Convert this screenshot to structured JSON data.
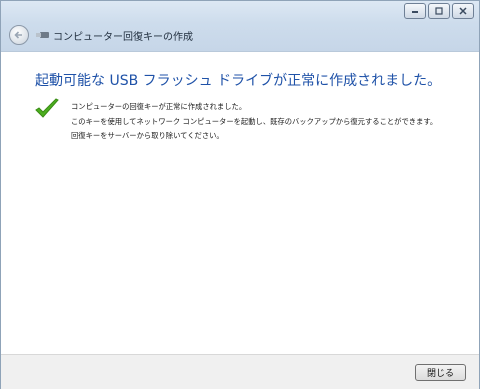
{
  "window": {
    "title": "コンピューター回復キーの作成",
    "controls": {
      "minimize": "minimize-icon",
      "maximize": "maximize-icon",
      "close": "close-icon"
    }
  },
  "main": {
    "heading": "起動可能な USB フラッシュ ドライブが正常に作成されました。",
    "messages": [
      "コンピューターの回復キーが正常に作成されました。",
      "このキーを使用してネットワーク コンピューターを起動し、既存のバックアップから復元することができます。",
      "回復キーをサーバーから取り除いてください。"
    ],
    "status_icon": "checkmark-icon"
  },
  "footer": {
    "close_label": "閉じる"
  },
  "colors": {
    "heading": "#1f52a8",
    "titlebar": "#cddcec",
    "check": "#4caf1f"
  }
}
